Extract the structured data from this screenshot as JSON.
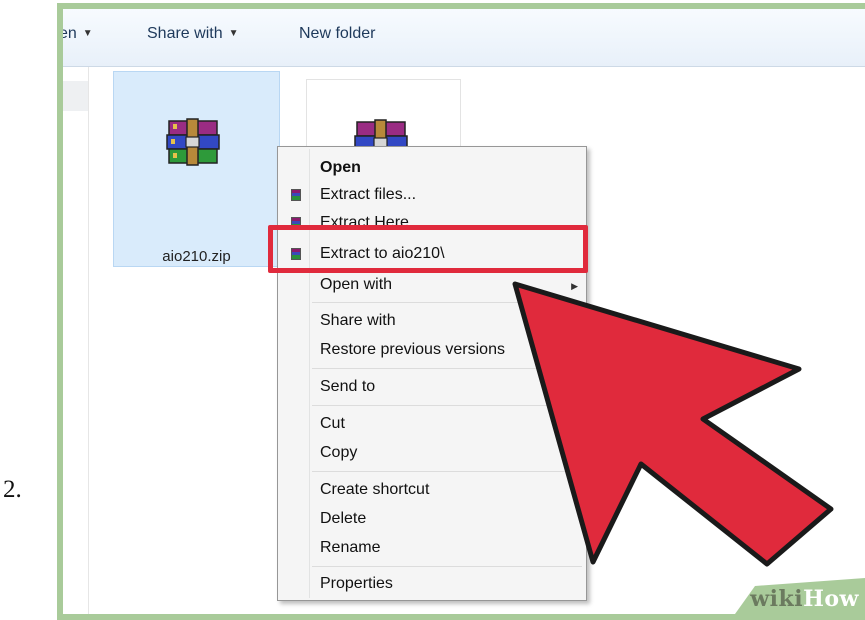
{
  "step": {
    "number": "2."
  },
  "toolbar": {
    "open_label": "en",
    "share_label": "Share with",
    "new_folder_label": "New folder"
  },
  "files": [
    {
      "name": "aio210.zip",
      "icon": "winrar-archive-icon",
      "selected": true
    },
    {
      "name": "",
      "icon": "winrar-archive-icon",
      "selected": false
    }
  ],
  "context_menu": {
    "items": [
      {
        "label": "Open",
        "bold": true,
        "icon": false
      },
      {
        "label": "Extract files...",
        "icon": true
      },
      {
        "label": "Extract Here",
        "icon": true
      },
      {
        "label": "Extract to aio210\\",
        "icon": true,
        "highlighted": true
      },
      {
        "label": "Open with",
        "submenu": true
      },
      {
        "label": "Share with",
        "submenu": true
      },
      {
        "label": "Restore previous versions"
      },
      {
        "label": "Send to",
        "submenu": true
      },
      {
        "label": "Cut"
      },
      {
        "label": "Copy"
      },
      {
        "label": "Create shortcut"
      },
      {
        "label": "Delete"
      },
      {
        "label": "Rename"
      },
      {
        "label": "Properties"
      }
    ]
  },
  "watermark": {
    "wiki": "wiki",
    "how": "How"
  },
  "colors": {
    "frame": "#a9cb9a",
    "highlight": "#e02a3c",
    "arrow_fill": "#e02a3c",
    "selection": "#d9ebfb"
  }
}
